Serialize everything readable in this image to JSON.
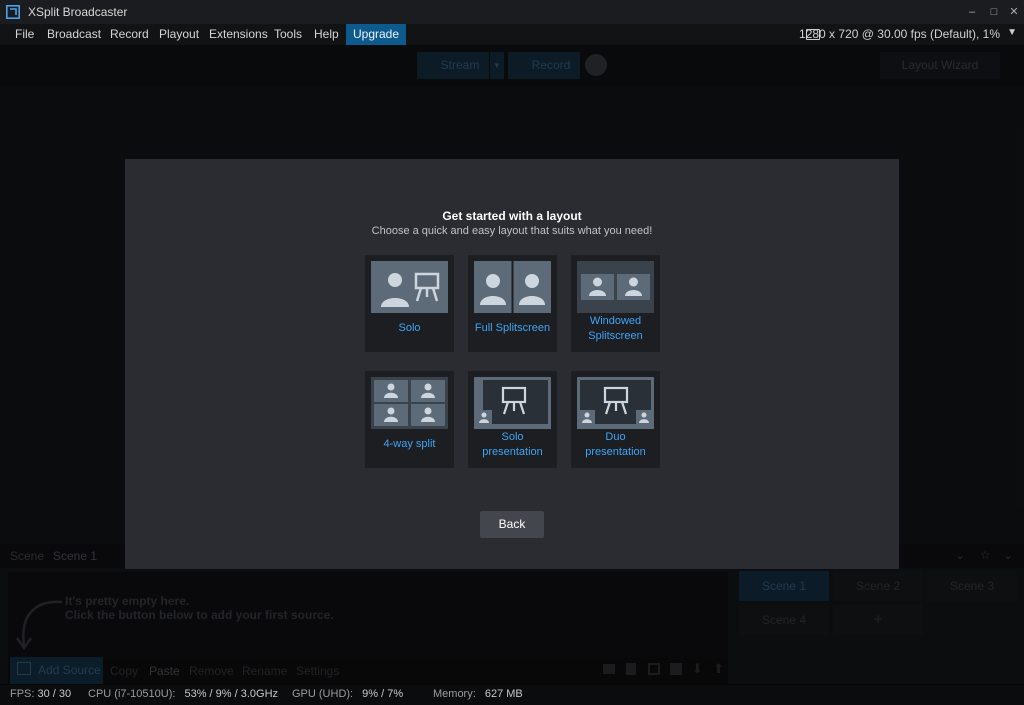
{
  "window": {
    "title": "XSplit Broadcaster",
    "controls": [
      "–",
      "□",
      "✕"
    ]
  },
  "menu": {
    "items": [
      "File",
      "Broadcast",
      "Record",
      "Playout",
      "Extensions",
      "Tools",
      "Help",
      "Upgrade"
    ],
    "resolution": "1280 x 720 @ 30.00 fps (Default), 1%"
  },
  "toolbar": {
    "stream": "Stream",
    "record": "Record",
    "layout_wizard": "Layout Wizard"
  },
  "scene": {
    "label": "Scene",
    "name": "Scene 1"
  },
  "sources": {
    "hint_line1": "It's pretty empty here.",
    "hint_line2": "Click the button below to add your first source.",
    "add": "Add Source",
    "copy": "Copy",
    "paste": "Paste",
    "remove": "Remove",
    "rename": "Rename",
    "settings": "Settings"
  },
  "scenes": [
    "Scene 1",
    "Scene 2",
    "Scene 3",
    "Scene 4",
    "+"
  ],
  "status": {
    "fps_label": "FPS:",
    "fps": "30 / 30",
    "cpu_label": "CPU (i7-10510U):",
    "cpu": "53% / 9% / 3.0GHz",
    "gpu_label": "GPU (UHD):",
    "gpu": "9% / 7%",
    "mem_label": "Memory:",
    "mem": "627 MB"
  },
  "dialog": {
    "title": "Get started with a layout",
    "subtitle": "Choose a quick and easy layout that suits what you need!",
    "layouts": [
      {
        "label": "Solo"
      },
      {
        "label": "Full Splitscreen"
      },
      {
        "label": "Windowed\nSplitscreen"
      },
      {
        "label": "4-way split"
      },
      {
        "label": "Solo\npresentation"
      },
      {
        "label": "Duo\npresentation"
      }
    ],
    "back": "Back"
  },
  "colors": {
    "accent": "#3fa4f5",
    "upgrade_bg": "#0e5a8c",
    "dialog_bg": "#2a2c31",
    "card_bg": "#1c1e22"
  }
}
